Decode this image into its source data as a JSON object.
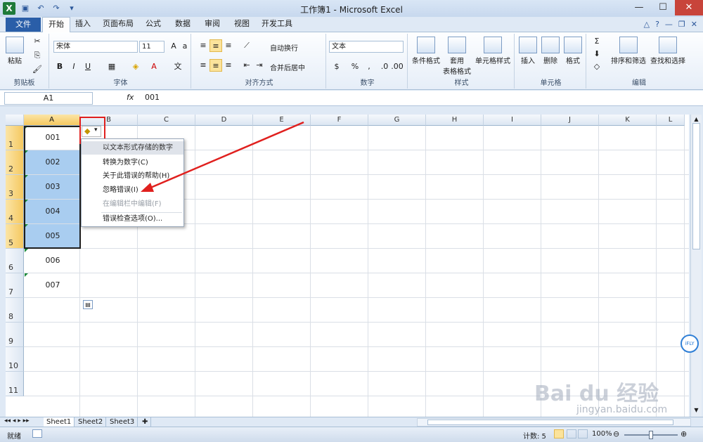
{
  "window": {
    "title": "工作簿1 - Microsoft Excel"
  },
  "tabs": [
    "文件",
    "开始",
    "插入",
    "页面布局",
    "公式",
    "数据",
    "审阅",
    "视图",
    "开发工具"
  ],
  "ribbon": {
    "clipboard": {
      "paste": "粘贴",
      "label": "剪贴板"
    },
    "font": {
      "name": "宋体",
      "size": "11",
      "label": "字体",
      "bold": "B",
      "italic": "I",
      "underline": "U"
    },
    "align": {
      "wrap": "自动换行",
      "merge": "合并后居中",
      "label": "对齐方式"
    },
    "number": {
      "format": "文本",
      "percent": "%",
      "comma": ",",
      "label": "数字"
    },
    "styles": {
      "cond": "条件格式",
      "table1": "套用",
      "table2": "表格格式",
      "cell": "单元格样式",
      "label": "样式"
    },
    "cells": {
      "insert": "插入",
      "delete": "删除",
      "format": "格式",
      "label": "单元格"
    },
    "edit": {
      "sort": "排序和筛选",
      "find": "查找和选择",
      "label": "编辑"
    }
  },
  "formula_bar": {
    "name_box": "A1",
    "fx": "fx",
    "value": "001"
  },
  "columns": [
    "A",
    "B",
    "C",
    "D",
    "E",
    "F",
    "G",
    "H",
    "I",
    "J",
    "K",
    "L"
  ],
  "rows": [
    "1",
    "2",
    "3",
    "4",
    "5",
    "6",
    "7",
    "8",
    "9",
    "10",
    "11"
  ],
  "cells": [
    "001",
    "002",
    "003",
    "004",
    "005",
    "006",
    "007"
  ],
  "context_menu": {
    "items": [
      "以文本形式存储的数字",
      "转换为数字(C)",
      "关于此错误的帮助(H)",
      "忽略错误(I)",
      "在编辑栏中编辑(F)",
      "错误检查选项(O)..."
    ]
  },
  "sheets": [
    "Sheet1",
    "Sheet2",
    "Sheet3"
  ],
  "status": {
    "ready": "就绪",
    "count": "计数: 5",
    "zoom": "100%"
  },
  "watermark": {
    "main": "Bai du 经验",
    "url": "jingyan.baidu.com",
    "ifly": "iFLY"
  },
  "colors": {
    "file_tab": "#2a5ea8",
    "selection": "#a9cdf0",
    "header_sel": "#f5c860",
    "highlight": "#e0201e"
  }
}
